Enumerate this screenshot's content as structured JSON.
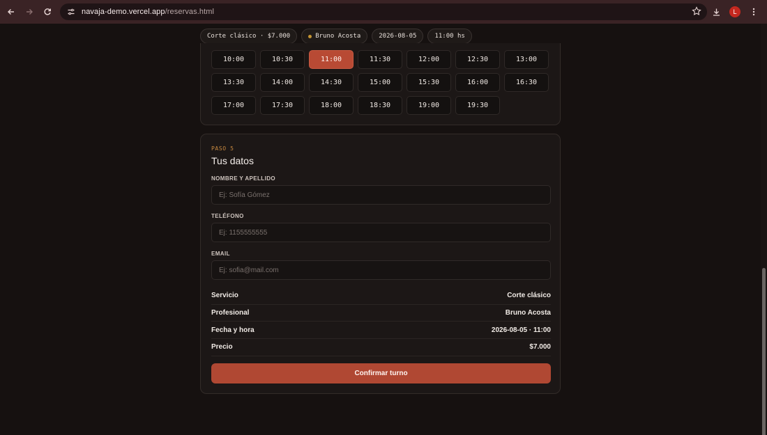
{
  "browser": {
    "url_host": "navaja-demo.vercel.app",
    "url_path": "/reservas.html",
    "avatar_letter": "L"
  },
  "summary_chips": [
    {
      "label": "Corte clásico · $7.000"
    },
    {
      "label": "Bruno Acosta",
      "dot_color": "#c49432"
    },
    {
      "label": "2026-08-05"
    },
    {
      "label": "11:00 hs"
    }
  ],
  "time_slots": {
    "selected": "11:00",
    "items": [
      "10:00",
      "10:30",
      "11:00",
      "11:30",
      "12:00",
      "12:30",
      "13:00",
      "13:30",
      "14:00",
      "14:30",
      "15:00",
      "15:30",
      "16:00",
      "16:30",
      "17:00",
      "17:30",
      "18:00",
      "18:30",
      "19:00",
      "19:30"
    ]
  },
  "form": {
    "step": "PASO 5",
    "title": "Tus datos",
    "name_label": "NOMBRE Y APELLIDO",
    "name_placeholder": "Ej: Sofía Gómez",
    "name_value": "",
    "phone_label": "TELÉFONO",
    "phone_placeholder": "Ej: 1155555555",
    "phone_value": "",
    "email_label": "EMAIL",
    "email_placeholder": "Ej: sofia@mail.com",
    "email_value": ""
  },
  "summary": {
    "rows": [
      {
        "label": "Servicio",
        "value": "Corte clásico"
      },
      {
        "label": "Profesional",
        "value": "Bruno Acosta"
      },
      {
        "label": "Fecha y hora",
        "value": "2026-08-05 · 11:00"
      },
      {
        "label": "Precio",
        "value": "$7.000"
      }
    ]
  },
  "confirm_label": "Confirmar turno",
  "colors": {
    "accent": "#b84a34",
    "background": "#161110",
    "card": "#1c1716",
    "step_label": "#c8893f"
  }
}
